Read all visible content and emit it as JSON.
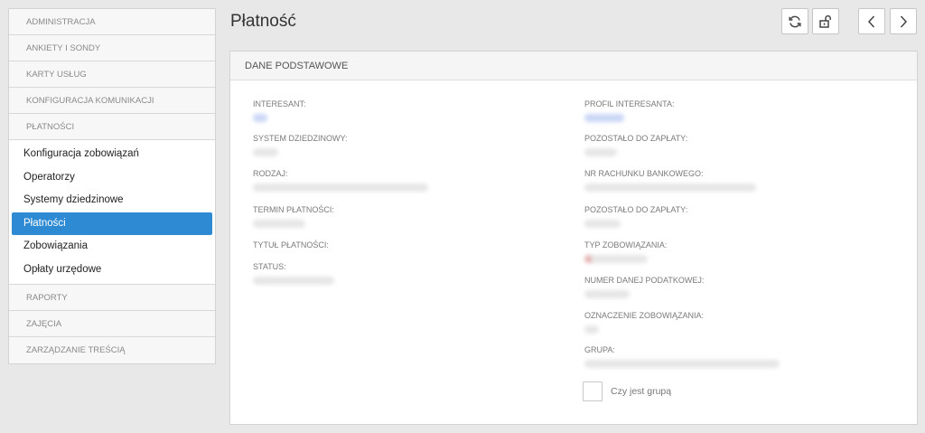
{
  "sidebar": {
    "sections_top": [
      "ADMINISTRACJA",
      "ANKIETY I SONDY",
      "KARTY USŁUG",
      "KONFIGURACJA KOMUNIKACJI",
      "PŁATNOŚCI"
    ],
    "items": [
      "Konfiguracja zobowiązań",
      "Operatorzy",
      "Systemy dziedzinowe",
      "Płatności",
      "Zobowiązania",
      "Opłaty urzędowe"
    ],
    "sections_bottom": [
      "RAPORTY",
      "ZAJĘCIA",
      "ZARZĄDZANIE TREŚCIĄ"
    ]
  },
  "header": {
    "title": "Płatność",
    "icons": [
      "refresh-icon",
      "unlock-icon",
      "chevron-left-icon",
      "chevron-right-icon"
    ]
  },
  "panel": {
    "title": "DANE PODSTAWOWE",
    "left_fields": [
      "INTERESANT:",
      "SYSTEM DZIEDZINOWY:",
      "RODZAJ:",
      "TERMIN PŁATNOŚCI:",
      "TYTUŁ PŁATNOŚCI:",
      "STATUS:"
    ],
    "right_fields": [
      "PROFIL INTERESANTA:",
      "POZOSTAŁO DO ZAPŁATY:",
      "NR RACHUNKU BANKOWEGO:",
      "POZOSTAŁO DO ZAPŁATY:",
      "TYP ZOBOWIĄZANIA:",
      "NUMER DANEJ PODATKOWEJ:",
      "OZNACZENIE ZOBOWIĄZANIA:",
      "GRUPA:"
    ],
    "checkbox_label": "Czy jest grupą"
  },
  "colors": {
    "accent": "#2d8ad3",
    "link": "#3a6fd8"
  }
}
